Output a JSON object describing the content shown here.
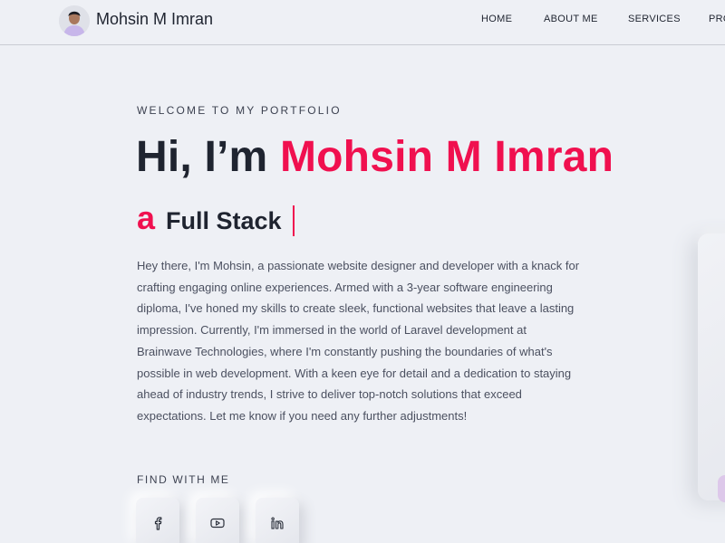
{
  "header": {
    "brand": "Mohsin M Imran",
    "avatar_icon": "user-avatar-icon",
    "nav": [
      {
        "label": "HOME"
      },
      {
        "label": "ABOUT ME"
      },
      {
        "label": "SERVICES"
      },
      {
        "label": "PRO"
      }
    ]
  },
  "hero": {
    "welcome": "WELCOME TO MY PORTFOLIO",
    "headline_prefix": "Hi, I’m ",
    "headline_name": "Mohsin M Imran",
    "typed_prefix": "a",
    "typed_text": "Full Stack",
    "bio": "Hey there, I'm Mohsin, a passionate website designer and developer with a knack for crafting engaging online experiences. Armed with a 3-year software engineering diploma, I've honed my skills to create sleek, functional websites that leave a lasting impression. Currently, I'm immersed in the world of Laravel development at Brainwave Technologies, where I'm constantly pushing the boundaries of what's possible in web development. With a keen eye for detail and a dedication to staying ahead of industry trends, I strive to deliver top-notch solutions that exceed expectations. Let me know if you need any further adjustments!",
    "find_label": "FIND WITH ME",
    "social": [
      {
        "icon": "facebook-icon"
      },
      {
        "icon": "youtube-icon"
      },
      {
        "icon": "linkedin-icon"
      }
    ]
  },
  "colors": {
    "accent": "#f0104f",
    "background": "#eef0f5",
    "text": "#1f2430"
  }
}
